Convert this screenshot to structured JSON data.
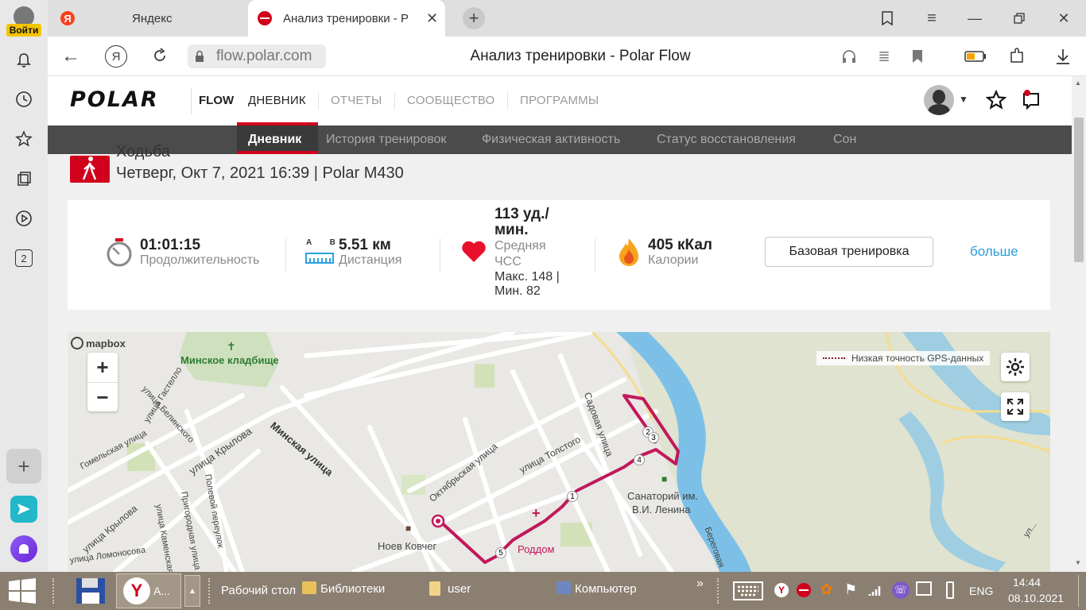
{
  "browser": {
    "login_label": "Войти",
    "tabs": [
      {
        "title": "Яндекс"
      },
      {
        "title": "Анализ тренировки - P"
      }
    ],
    "address_url": "flow.polar.com",
    "page_title": "Анализ тренировки - Polar Flow",
    "left_bar_badge": "2"
  },
  "polar": {
    "logo": "POLAR",
    "flow": "FLOW",
    "nav": [
      "ДНЕВНИК",
      "ОТЧЕТЫ",
      "СООБЩЕСТВО",
      "ПРОГРАММЫ"
    ],
    "active_nav": "ДНЕВНИК",
    "subnav": [
      "Дневник",
      "История тренировок",
      "Физическая активность",
      "Статус восстановления",
      "Сон"
    ],
    "accent": "#d0021b"
  },
  "session": {
    "sport": "Ходьба",
    "date_device": "Четверг, Окт 7, 2021 16:39 | Polar M430"
  },
  "summary": {
    "duration_value": "01:01:15",
    "duration_label": "Продолжительность",
    "distance_ab": "A B",
    "distance_value": "5.51 км",
    "distance_label": "Дистанция",
    "hr_value": "113 уд./мин.",
    "hr_label": "Средняя ЧСС",
    "hr_minmax": "Макс. 148 | Мин. 82",
    "calories_value": "405 кКал",
    "calories_label": "Калории",
    "training_button": "Базовая тренировка",
    "more_link": "больше"
  },
  "map": {
    "attribution": "mapbox",
    "zoom_in": "+",
    "zoom_out": "−",
    "gps_legend": "Низкая точность GPS-данных",
    "labels": {
      "cemetery": "Минское кладбище",
      "minskaya": "Минская улица",
      "gastello": "улица Гастелло",
      "belinsky": "улица Белинского",
      "gomelskaya": "Гомельская улица",
      "krylova1": "улица Крылова",
      "krylova2": "улица Крылова",
      "polevoy": "Полевой переулок",
      "prigorodnaya": "Пригородная улица",
      "kamenskaya": "улица Каменская",
      "lomonosova": "улица Ломоносова",
      "oktyabrskaya": "Октябрьская улица",
      "tolstogo": "улица Толстого",
      "sadovaya": "Садовая улица",
      "sanatory1": "Санаторий им.",
      "sanatory2": "В.И. Ленина",
      "noev": "Ноев Ковчег",
      "roddom": "Роддом",
      "beregovaya": "Береговая",
      "ulitsa_dots": "ул..."
    },
    "markers": [
      "1",
      "2",
      "3",
      "4",
      "5"
    ]
  },
  "taskbar": {
    "app_label": "А...",
    "desktop": "Рабочий стол",
    "libraries": "Библиотеки",
    "user": "user",
    "computer": "Компьютер",
    "chevron": "»",
    "lang": "ENG",
    "time": "14:44",
    "date": "08.10.2021"
  }
}
